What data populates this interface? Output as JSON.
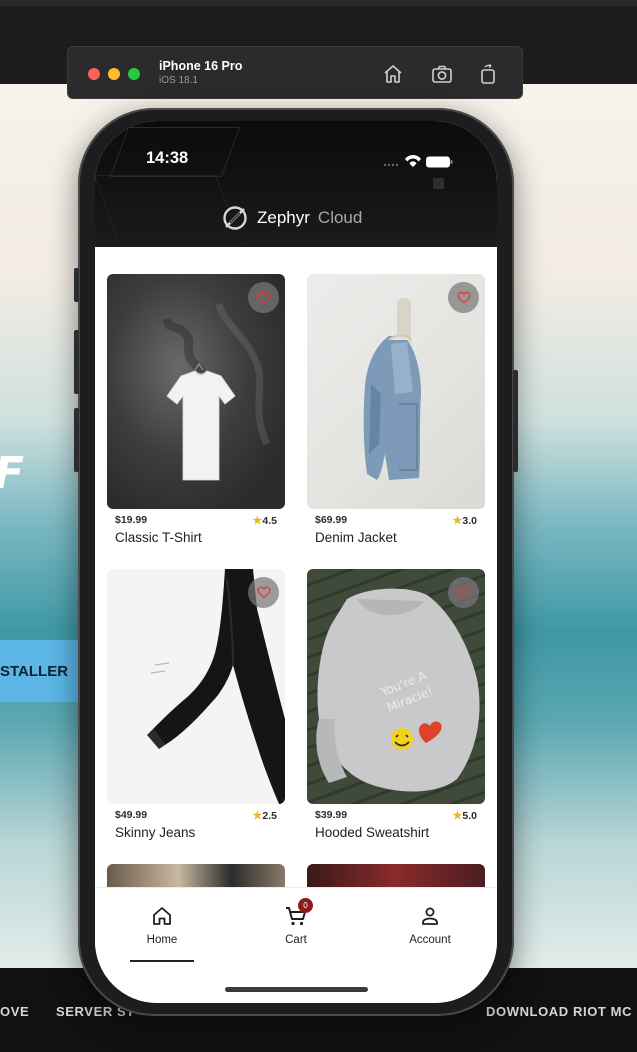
{
  "simulator": {
    "device_name": "iPhone 16 Pro",
    "os_version": "iOS 18.1",
    "toolbar_icons": [
      "home-icon",
      "screenshot-icon",
      "rotate-icon"
    ]
  },
  "background_page": {
    "installer_text": "STALLER",
    "footer_items": [
      "OVE",
      "SERVER ST",
      "DOWNLOAD RIOT MC"
    ]
  },
  "status_bar": {
    "time": "14:38"
  },
  "header": {
    "brand_name": "Zephyr",
    "brand_suffix": "Cloud"
  },
  "products": [
    {
      "price": "$19.99",
      "rating": "4.5",
      "name": "Classic T-Shirt"
    },
    {
      "price": "$69.99",
      "rating": "3.0",
      "name": "Denim Jacket"
    },
    {
      "price": "$49.99",
      "rating": "2.5",
      "name": "Skinny Jeans"
    },
    {
      "price": "$39.99",
      "rating": "5.0",
      "name": "Hooded Sweatshirt"
    }
  ],
  "image_text": {
    "sweatshirt_print": "You're A Miracle!"
  },
  "tabs": {
    "home": {
      "label": "Home",
      "icon": "home-icon",
      "selected": true
    },
    "cart": {
      "label": "Cart",
      "icon": "cart-icon",
      "badge": "0"
    },
    "account": {
      "label": "Account",
      "icon": "person-icon"
    }
  },
  "colors": {
    "accent_badge": "#8d1b1b",
    "star": "#e8b923",
    "heart": "#e53935"
  }
}
